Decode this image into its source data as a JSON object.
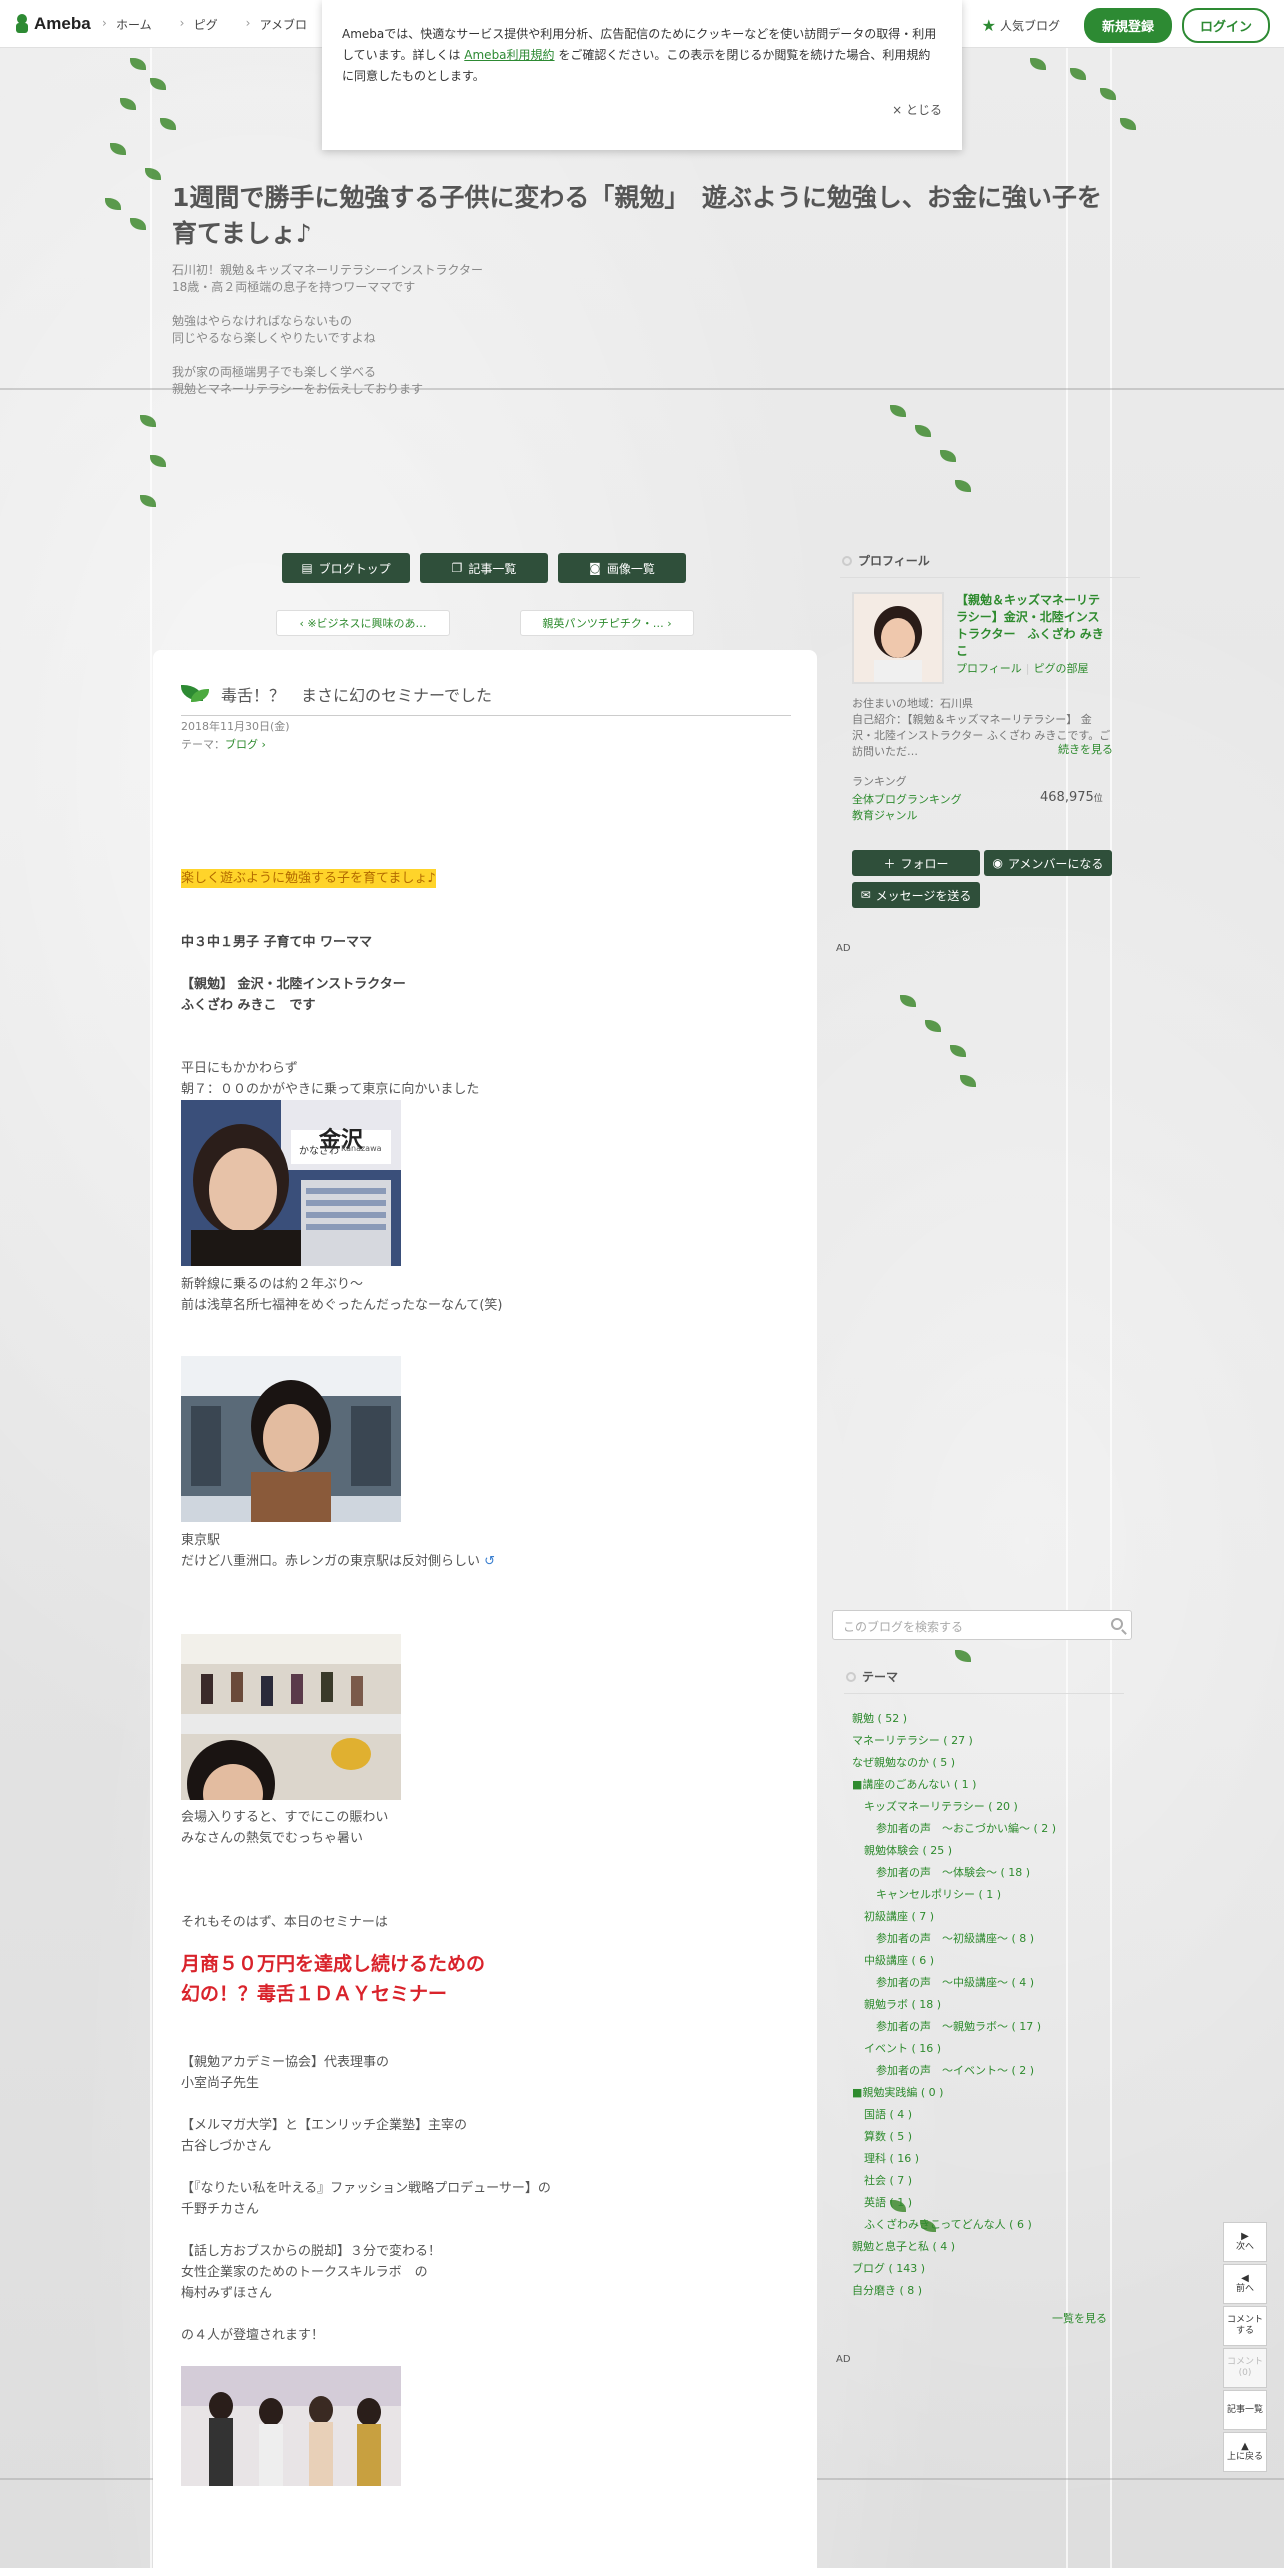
{
  "topbar": {
    "logo": "Ameba",
    "nav": [
      "ホーム",
      "ピグ",
      "アメブロ"
    ],
    "popular": "人気ブログ",
    "signup": "新規登録",
    "login": "ログイン"
  },
  "cookie": {
    "text_before": "Amebaでは、快適なサービス提供や利用分析、広告配信のためにクッキーなどを使い訪問データの取得・利用しています。詳しくは",
    "terms_link": "Ameba利用規約",
    "text_after": "をご確認ください。この表示を閉じるか閲覧を続けた場合、利用規約に同意したものとします。",
    "close": "× とじる"
  },
  "header": {
    "title": "1週間で勝手に勉強する子供に変わる「親勉」　遊ぶように勉強し、お金に強い子を育てましょ♪",
    "desc": "石川初！親勉＆キッズマネーリテラシーインストラクター\n18歳・高２両極端の息子を持つワーママです\n\n勉強はやらなければならないもの\n同じやるなら楽しくやりたいですよね\n\n我が家の両極端男子でも楽しく学べる\n親勉とマネーリテラシーをお伝えしております"
  },
  "navButtons": {
    "top": "ブログトップ",
    "list": "記事一覧",
    "images": "画像一覧",
    "prev": "※ビジネスに興味のあ…",
    "next": "親英パンツチピチク・…"
  },
  "article": {
    "title": "毒舌！？　まさに幻のセミナーでした",
    "date": "2018年11月30日(金)",
    "theme_label": "テーマ：",
    "theme": "ブログ",
    "lines": {
      "highlight": "楽しく遊ぶように勉強する子を育てましょ♪",
      "l1": "中３中１男子 子育て中 ワーママ",
      "l2": "【親勉】 金沢・北陸インストラクター",
      "l3": "ふくざわ みきこ　です",
      "l4": "平日にもかかわらず",
      "l5": "朝７：００のかがやきに乗って東京に向かいました",
      "l6": "新幹線に乗るのは約２年ぶり～",
      "l7": "前は浅草名所七福神をめぐったんだったなーなんて(笑)",
      "l8": "東京駅",
      "l9": "だけど八重洲口。赤レンガの東京駅は反対側らしい",
      "l10": "会場入りすると、すでにこの賑わい",
      "l11": "みなさんの熱気でむっちゃ暑い",
      "l12": "それもそのはず、本日のセミナーは",
      "red1": "月商５０万円を達成し続けるための",
      "red2": "幻の！？毒舌１ＤＡＹセミナー",
      "l13": "【親勉アカデミー協会】代表理事の",
      "l14": "小室尚子先生",
      "l15": "【メルマガ大学】と【エンリッチ企業塾】主宰の",
      "l16": "古谷しづかさん",
      "l17": "【『なりたい私を叶える』ファッション戦略プロデューサー】の",
      "l18": "千野チカさん",
      "l19": "【話し方おブスからの脱却】３分で変わる！",
      "l20": "女性企業家のためのトークスキルラボ　の",
      "l21": "梅村みずほさん",
      "l22": "の４人が登壇されます！"
    },
    "sign_text": "金沢",
    "sign_kana": "かなざわ",
    "sign_roman": "Kanazawa"
  },
  "sidebar": {
    "profile_title": "プロフィール",
    "profile_name": "【親勉＆キッズマネーリテラシー】金沢・北陸インストラクター　ふくざわ みきこ",
    "profile_link": "プロフィール",
    "pigg_link": "ピグの部屋",
    "location": "お住まいの地域：石川県",
    "intro": "自己紹介：【親勉＆キッズマネーリテラシー】 金沢・北陸インストラクター ふくざわ みきこです。ご訪問いただ…",
    "more": "続きを見る",
    "ranking_label": "ランキング",
    "rank_all": "全体ブログランキング",
    "rank_value": "468,975",
    "rank_unit": "位",
    "genre": "教育ジャンル",
    "follow": "フォロー",
    "member": "アメンバーになる",
    "message": "メッセージを送る",
    "ad": "AD",
    "search_placeholder": "このブログを検索する",
    "theme_title": "テーマ",
    "themes": [
      "親勉 ( 52 )",
      "マネーリテラシー ( 27 )",
      "なぜ親勉なのか ( 5 )",
      "■講座のごあんない ( 1 )",
      "キッズマネーリテラシー ( 20 )",
      "参加者の声　～おこづかい編～ ( 2 )",
      "親勉体験会 ( 25 )",
      "参加者の声　～体験会～ ( 18 )",
      "キャンセルポリシー ( 1 )",
      "初級講座 ( 7 )",
      "参加者の声　～初級講座～ ( 8 )",
      "中級講座 ( 6 )",
      "参加者の声　〜中級講座〜 ( 4 )",
      "親勉ラボ ( 18 )",
      "参加者の声　～親勉ラボ～ ( 17 )",
      "イベント ( 16 )",
      "参加者の声　～イベント～ ( 2 )",
      "■親勉実践編 ( 0 )",
      "国語 ( 4 )",
      "算数 ( 5 )",
      "理科 ( 16 )",
      "社会 ( 7 )",
      "英語 ( 1 )",
      "ふくざわみきこってどんな人 ( 6 )",
      "親勉と息子と私 ( 4 )",
      "ブログ ( 143 )",
      "自分磨き ( 8 )"
    ],
    "see_all": "一覧を見る"
  },
  "floatnav": {
    "next": "次へ",
    "prev": "前へ",
    "comment": "コメントする",
    "comment_count": "コメント(0)",
    "list": "記事一覧",
    "top": "上に戻る"
  },
  "colors": {
    "brand_green": "#2d8a33",
    "dark_button": "#2f4f3a",
    "highlight": "#ffd42a",
    "red_text": "#d9232b"
  }
}
